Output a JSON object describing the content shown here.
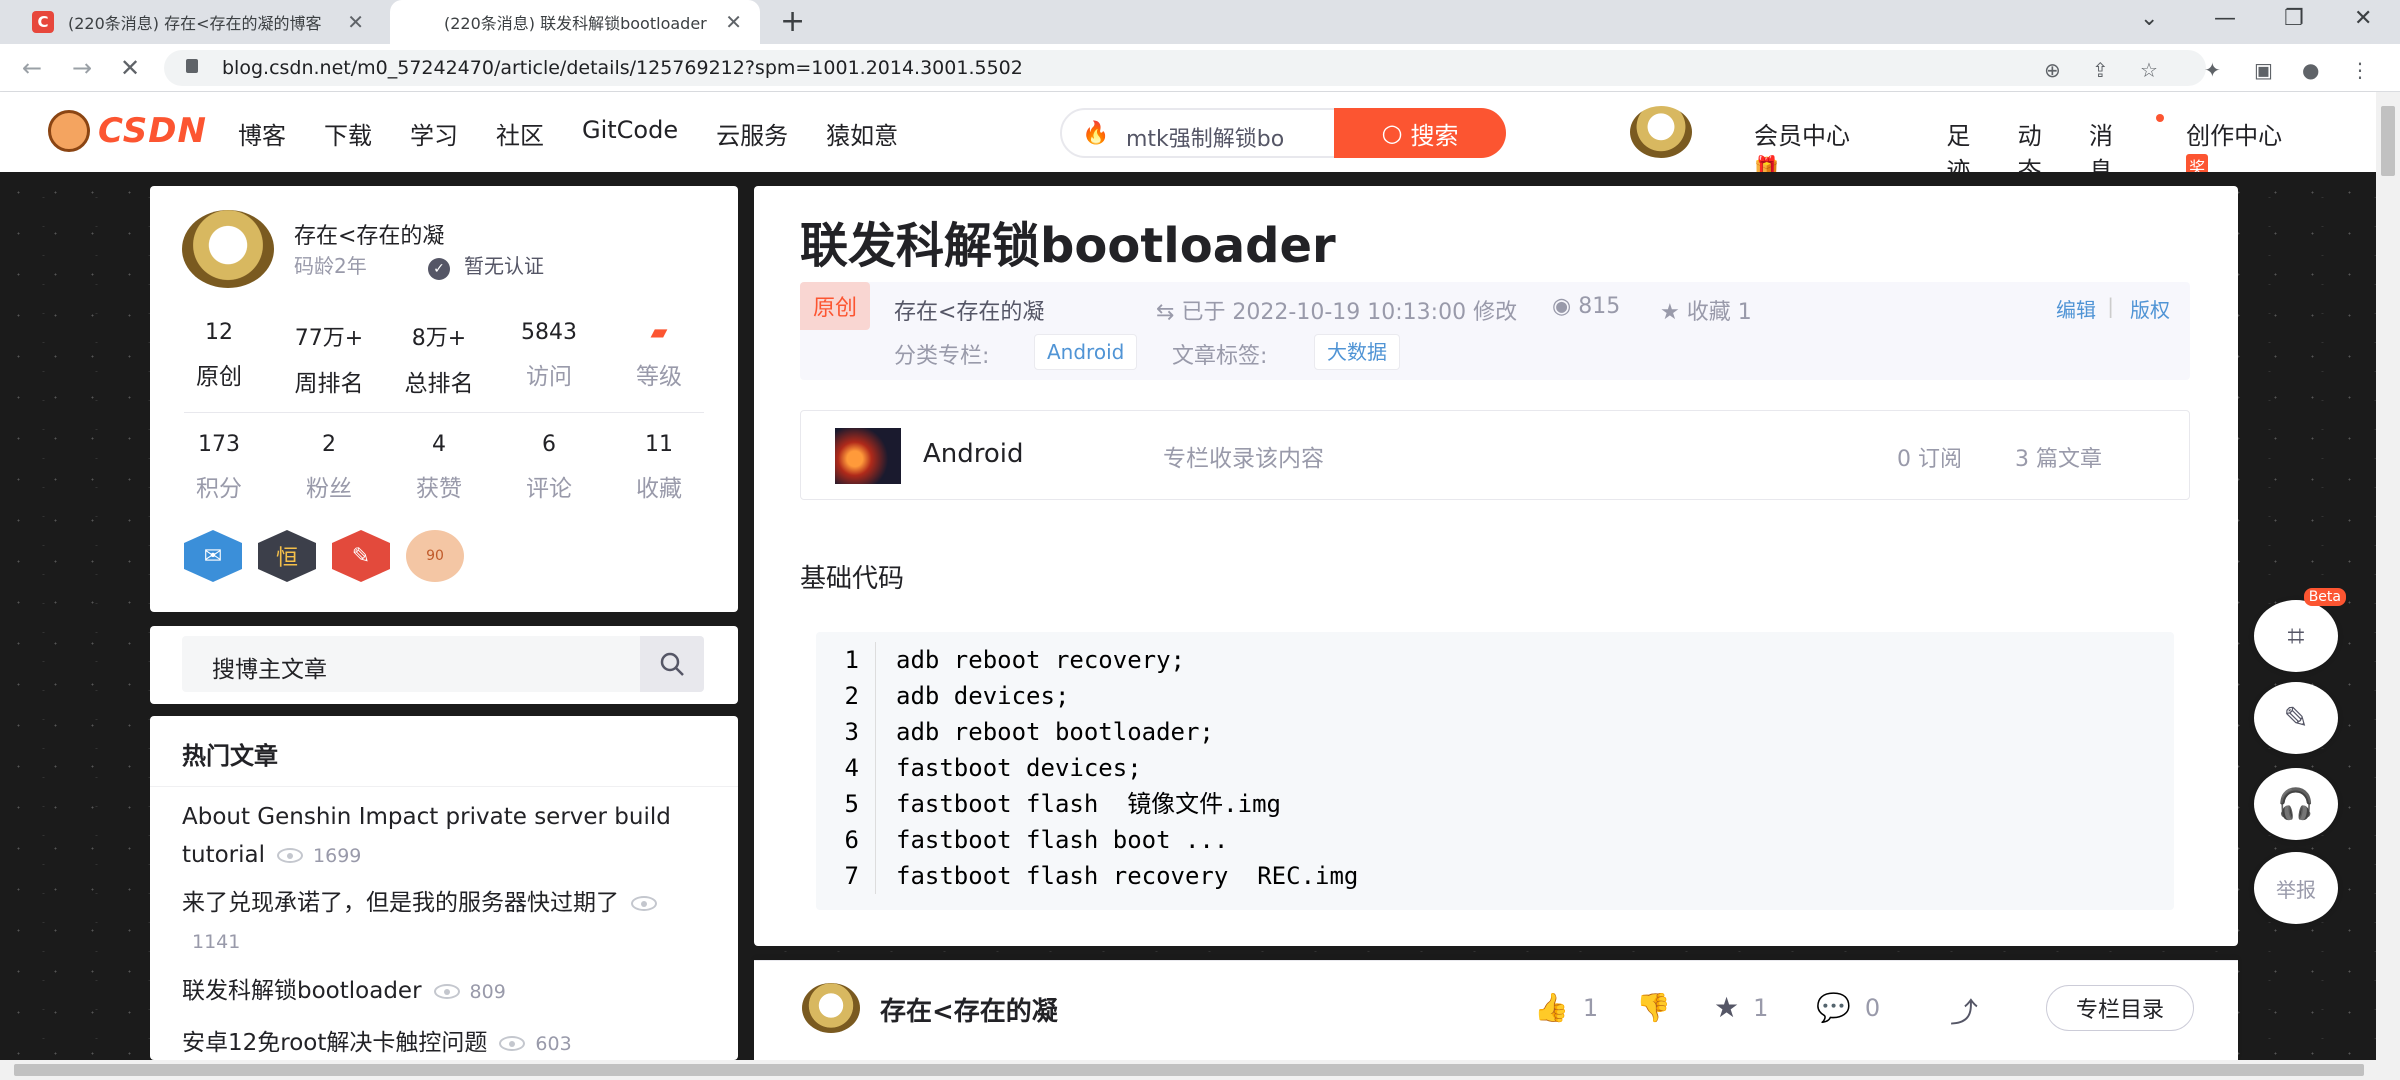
{
  "browser": {
    "tabs": [
      {
        "title": "(220条消息) 存在<存在的凝的博客",
        "favicon": "csdn-icon"
      },
      {
        "title": "(220条消息) 联发科解锁bootloader",
        "favicon": "loading-icon"
      }
    ],
    "url": "blog.csdn.net/m0_57242470/article/details/125769212?spm=1001.2014.3001.5502"
  },
  "header": {
    "logo_text": "CSDN",
    "nav": [
      "博客",
      "下载",
      "学习",
      "社区",
      "GitCode",
      "云服务",
      "猿如意"
    ],
    "search_query": "mtk强制解锁bo",
    "search_button": "搜索",
    "right_nav": {
      "member": "会员中心",
      "footprint": "足迹",
      "dynamic": "动态",
      "messages": "消息",
      "creator": "创作中心",
      "creator_badge": "奖"
    }
  },
  "profile": {
    "name": "存在<存在的凝",
    "code_age": "码龄2年",
    "cert": "暂无认证",
    "stats_row1": [
      {
        "num": "12",
        "label": "原创"
      },
      {
        "num": "77万+",
        "label": "周排名"
      },
      {
        "num": "8万+",
        "label": "总排名"
      },
      {
        "num": "5843",
        "label": "访问"
      },
      {
        "num": "",
        "label": "等级"
      }
    ],
    "stats_row2": [
      {
        "num": "173",
        "label": "积分"
      },
      {
        "num": "2",
        "label": "粉丝"
      },
      {
        "num": "4",
        "label": "获赞"
      },
      {
        "num": "6",
        "label": "评论"
      },
      {
        "num": "11",
        "label": "收藏"
      }
    ],
    "medal_90": "90"
  },
  "blog_search": {
    "placeholder": "搜博主文章"
  },
  "hot": {
    "title": "热门文章",
    "items": [
      {
        "title": "About Genshin Impact private server build tutorial",
        "views": "1699"
      },
      {
        "title": "来了兑现承诺了，但是我的服务器快过期了",
        "views": "1141"
      },
      {
        "title": "联发科解锁bootloader",
        "views": "809"
      },
      {
        "title": "安卓12免root解决卡触控问题",
        "views": "603"
      }
    ]
  },
  "article": {
    "title": "联发科解锁bootloader",
    "original": "原创",
    "author": "存在<存在的凝",
    "modified": "已于 2022-10-19 10:13:00 修改",
    "reads": "815",
    "favorites": "收藏 1",
    "edit": "编辑",
    "copyright": "版权",
    "category_label": "分类专栏:",
    "category": "Android",
    "tags_label": "文章标签:",
    "tag": "大数据",
    "column": {
      "name": "Android",
      "desc": "专栏收录该内容",
      "subs": "0 订阅",
      "count": "3 篇文章"
    },
    "section_heading": "基础代码",
    "code_numbers": [
      "1",
      "2",
      "3",
      "4",
      "5",
      "6",
      "7"
    ],
    "code_lines": [
      "adb reboot recovery;",
      "adb devices;",
      "adb reboot bootloader;",
      "fastboot devices;",
      "fastboot flash  镜像文件.img",
      "fastboot flash boot ...",
      "fastboot flash recovery  REC.img"
    ]
  },
  "author_bar": {
    "name": "存在<存在的凝",
    "likes": "1",
    "favorites": "1",
    "comments": "0",
    "toc": "专栏目录"
  },
  "floating": {
    "beta": "Beta",
    "report": "举报"
  }
}
